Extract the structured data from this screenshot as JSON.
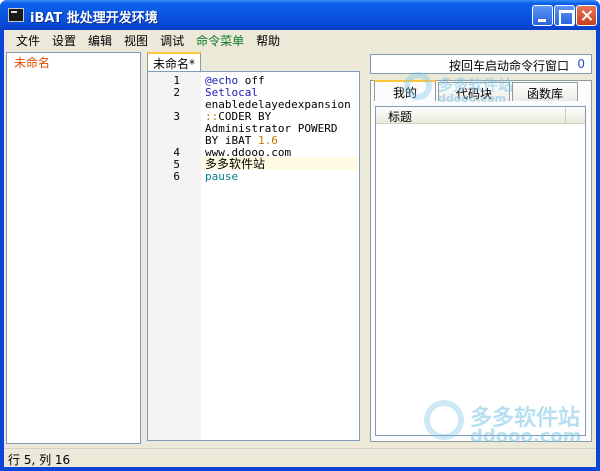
{
  "window": {
    "title": "iBAT  批处理开发环境"
  },
  "menu": [
    "文件",
    "设置",
    "编辑",
    "视图",
    "调试",
    "命令菜单",
    "帮助"
  ],
  "left_panel": {
    "items": [
      "未命名"
    ]
  },
  "editor": {
    "tab_label": "未命名*",
    "lines": [
      {
        "num": "1",
        "text": "@echo off"
      },
      {
        "num": "2",
        "text": "Setlocal enabledelayedexpansion"
      },
      {
        "num": "3",
        "text": "::CODER BY Administrator POWERD BY iBAT 1.6"
      },
      {
        "num": "4",
        "text": "www.ddooo.com"
      },
      {
        "num": "5",
        "text": "多多软件站"
      },
      {
        "num": "6",
        "text": "pause"
      }
    ]
  },
  "right_panel": {
    "cmd_label": "按回车启动命令行窗口",
    "cmd_count": "0",
    "tabs": [
      "我的",
      "代码块",
      "函数库"
    ],
    "list_header": "标题"
  },
  "watermark": {
    "brand": "多多软件站",
    "domain": "ddooo.com"
  },
  "status": {
    "text": "行 5, 列 16"
  },
  "colors": {
    "titlebar": "#0a56e1",
    "highlight_line": "#fffbe2",
    "tab_accent": "#ffc83c",
    "tree_item": "#e04a00"
  }
}
